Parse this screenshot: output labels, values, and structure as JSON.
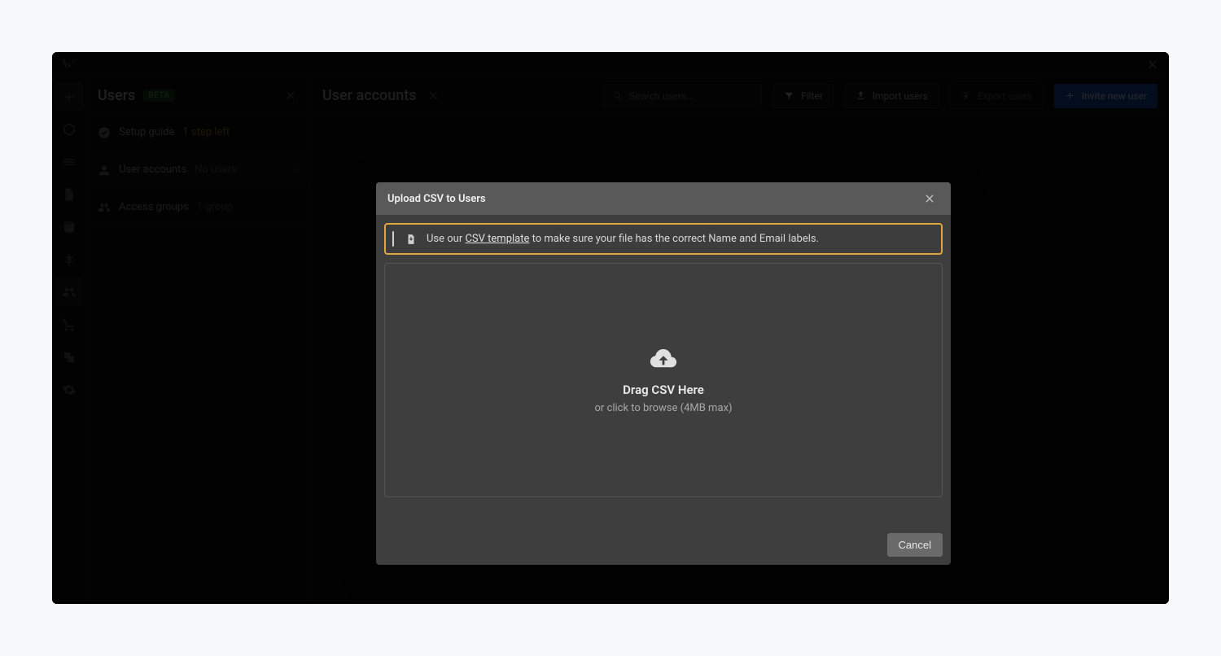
{
  "panel": {
    "title": "Users",
    "badge": "BETA",
    "rows": {
      "setup": {
        "label": "Setup guide",
        "status": "1 step left"
      },
      "accounts": {
        "label": "User accounts",
        "status": "No users"
      },
      "groups": {
        "label": "Access groups",
        "status": "1 group"
      }
    }
  },
  "main": {
    "title": "User accounts",
    "search_placeholder": "Search users...",
    "buttons": {
      "filter": "Filter",
      "import": "Import users",
      "export": "Export users",
      "invite": "Invite new user"
    }
  },
  "modal": {
    "title": "Upload CSV to Users",
    "callout_prefix": "Use our ",
    "callout_link": "CSV template",
    "callout_suffix": " to make sure your file has the correct Name and Email labels.",
    "drop_title": "Drag CSV Here",
    "drop_sub": "or click to browse (4MB max)",
    "cancel": "Cancel"
  }
}
